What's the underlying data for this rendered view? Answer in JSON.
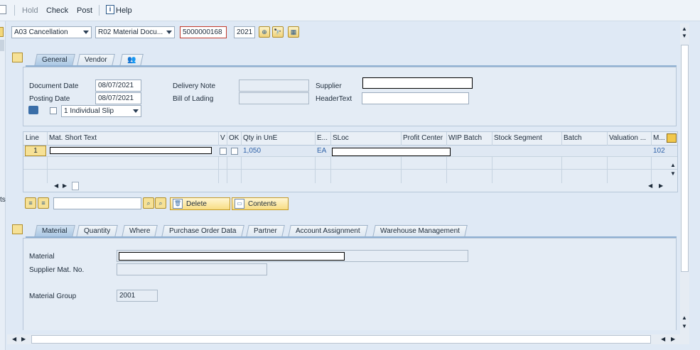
{
  "toolbar": {
    "hold": "Hold",
    "check": "Check",
    "post": "Post",
    "help": "Help",
    "help_icon": "i"
  },
  "header": {
    "transaction": "A03 Cancellation",
    "reference": "R02 Material Docu...",
    "doc_number": "5000000168",
    "year": "2021"
  },
  "tabs_top": {
    "general": "General",
    "vendor": "Vendor"
  },
  "general": {
    "document_date_label": "Document Date",
    "document_date": "08/07/2021",
    "posting_date_label": "Posting Date",
    "posting_date": "08/07/2021",
    "delivery_note_label": "Delivery Note",
    "bill_of_lading_label": "Bill of Lading",
    "supplier_label": "Supplier",
    "header_text_label": "HeaderText",
    "slip_option": "1 Individual Slip"
  },
  "items_table": {
    "columns": [
      "Line",
      "Mat. Short Text",
      "V",
      "OK",
      "Qty in UnE",
      "E...",
      "SLoc",
      "Profit Center",
      "WIP Batch",
      "Stock Segment",
      "Batch",
      "Valuation ...",
      "M..."
    ],
    "rows": [
      {
        "line": "1",
        "qty": "1,050",
        "unit": "EA",
        "movement": "102"
      }
    ]
  },
  "item_buttons": {
    "delete": "Delete",
    "contents": "Contents"
  },
  "tabs_bottom": [
    "Material",
    "Quantity",
    "Where",
    "Purchase Order Data",
    "Partner",
    "Account Assignment",
    "Warehouse Management"
  ],
  "material": {
    "material_label": "Material",
    "supplier_mat_label": "Supplier Mat. No.",
    "group_label": "Material Group",
    "group_value": "2001"
  },
  "left_edge": {
    "fragment": "ts"
  },
  "colors": {
    "bg": "#dfe9f5",
    "accent": "#f8dd84",
    "link": "#2f62a8"
  }
}
